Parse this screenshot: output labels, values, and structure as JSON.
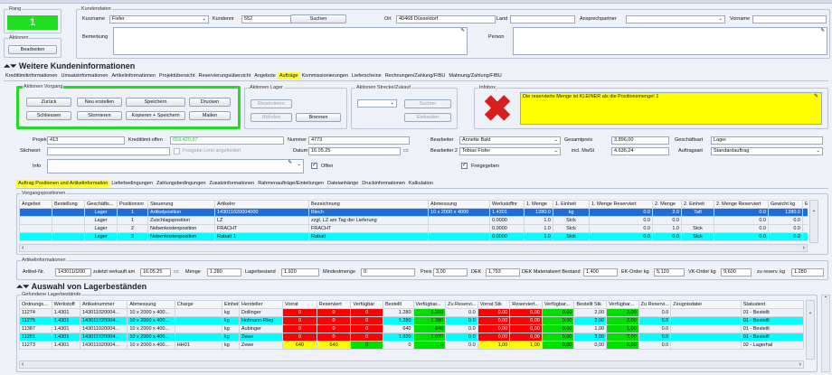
{
  "rang": {
    "label": "Rang",
    "value": "1"
  },
  "aktionen": {
    "label": "Aktionen",
    "bearbeiten": "Bearbeiten"
  },
  "kundendaten": {
    "label": "Kundendaten",
    "kurzname_label": "Kurzname",
    "kurzname": "Fisfer",
    "kundennr_label": "Kundennr",
    "kundennr": "552",
    "suchen": "Suchen",
    "ort_label": "Ort",
    "ort": "40468 Düsseldorf",
    "land_label": "Land",
    "ansprech_label": "Ansprechpartner",
    "vorname_label": "Vorname",
    "bemerkung_label": "Bemerkung",
    "person_label": "Person"
  },
  "weitere_title": "Weitere Kundeninformationen",
  "main_tabs": [
    "Kreditlimitinformationen",
    "Umsatzinformationen",
    "Artikelinformationen",
    "Projektübersicht",
    "Reservierungsübersicht",
    "Angebote",
    "Aufträge",
    "Kommissionierungen",
    "Lieferscheine",
    "Rechnungen/Zahlung/FIBU",
    "Mahnung/Zahlung/FIBU"
  ],
  "main_tab_active": 6,
  "vorgang": {
    "label": "Aktionen Vorgang",
    "buttons": [
      "Zurück",
      "Neu erstellen",
      "Speichern",
      "Drucken",
      "Schliessen",
      "Stornieren",
      "Kopieren + Speichern",
      "Mailen"
    ]
  },
  "lager": {
    "label": "Aktionen Lager",
    "reservieren": "Reservieren",
    "abholen": "Abholen",
    "brennen": "Brennen"
  },
  "strecke": {
    "label": "Aktionen Strecke/Zukauf",
    "suchen": "Suchen",
    "einkaufen": "Einkaufen"
  },
  "infobox": {
    "label": "Infobox",
    "message": "Die reservierte Menge ist KLEINER als die Positionsmenge! 1"
  },
  "form": {
    "projekt_label": "Projekt",
    "projekt": "413",
    "kredit_label": "Kreditlimit offen",
    "kredit": "659.420,97",
    "nummer_label": "Nummer",
    "nummer": "4773",
    "bearbeiter_label": "Bearbeiter",
    "bearbeiter": "Annette Bald",
    "gesamt_label": "Gesamtpreis",
    "gesamt": "3.896,00",
    "gart_label": "Geschäftsart",
    "gart": "Lager",
    "stichwort_label": "Stichwort",
    "freigabe_label": "Freigabe Limit angefordert",
    "datum_label": "Datum",
    "datum": "16.05.25",
    "bearbeiter2_label": "Bearbeiter 2",
    "bearbeiter2": "Tobias Fisfer",
    "mwst_label": "incl. MwSt",
    "mwst": "4.636,24",
    "aart_label": "Auftragsart",
    "aart": "Standardauftrag",
    "info_label": "Info",
    "offen_label": "Offen",
    "freigegeben_label": "Freigegeben"
  },
  "sub_tabs": [
    "Auftrag Positionen und Artikelinformation",
    "Lieferbedingungen",
    "Zahlungsbedingungen",
    "Zusatzinformationen",
    "Rahmenaufträge/Einteilungen",
    "Dateianhänge",
    "Druckinformationen",
    "Kalkulation"
  ],
  "positionen": {
    "label": "Vorgangspositionen",
    "headers": [
      "Angebot",
      "Bestellung",
      "Geschäfts...",
      "Positionsnr",
      "Steuerung",
      "Artikelnr",
      "Bezeichnung",
      "Abmessung",
      "Werkstoffnr",
      "1. Menge",
      "1. Einheit",
      "1. Menge Reserviert",
      "2. Menge",
      "2. Einheit",
      "2. Menge Reserviert",
      "Gewicht kg",
      "Einzelpreis",
      "f"
    ],
    "rows": [
      [
        "",
        "",
        "Lager",
        "1",
        "Artikelposition",
        "143011020004000",
        "Blech",
        "10 x 2000 x 4000",
        "1.4301",
        "1280.0",
        "kg",
        "0.0",
        "2.0",
        "Tafl",
        "0.0",
        "1280.0",
        "3.0",
        ""
      ],
      [
        "",
        "",
        "Lager",
        "1",
        "Zuschlagsposition",
        "LZ",
        "zzgl. LZ am Tag der Lieferung",
        "",
        "0.0000",
        "1.0",
        "Stck",
        "0.0",
        "0.0",
        "",
        "0.0",
        "0.0",
        "1.0",
        ""
      ],
      [
        "",
        "",
        "Lager",
        "2",
        "Nebenkostenposition",
        "FRACHT",
        "FRACHT",
        "",
        "0.0000",
        "1.0",
        "Stck",
        "0.0",
        "1.0",
        "Stck",
        "0.0",
        "0.0",
        "50.0",
        ""
      ],
      [
        "",
        "",
        "Lager",
        "3",
        "Nebenkostenposition",
        "Rabatt 1",
        "Rabatt",
        "",
        "0.0000",
        "1.0",
        "Stck",
        "0.0",
        "0.0",
        "Stck",
        "0.0",
        "0.0",
        "5.0",
        ""
      ]
    ]
  },
  "artikel": {
    "label": "Artikelinformationen",
    "nr_label": "Artikel-Nr.",
    "nr": "1430110200",
    "zuletzt_label": "zuletzt verkauft am",
    "zuletzt": "16.05.25",
    "menge_label": "Menge",
    "menge": "1.280",
    "lagerbestand_label": "Lagerbestand",
    "lagerbestand": "1.920",
    "mindest_label": "Mindestmenge",
    "mindest": "0",
    "preis_label": "Preis",
    "preis": "3,00",
    "dek_label": "DEK",
    "dek": "1,793",
    "dekmat_label": "DEK Materialwert Bestand",
    "dekmat": "1,400",
    "ek_label": "EK-Order kg",
    "ek": "5,120",
    "vk_label": "VK-Order kg",
    "vk": "9,600",
    "zures_label": "zu reserv. kg",
    "zures": "1.280"
  },
  "lager_title": "Auswahl von Lagerbeständen",
  "bestaende": {
    "label": "Gefundene Lagerbestände",
    "headers": [
      "Ordnungs...",
      "Werkstoff",
      "Artikelnummer",
      "Abmessung",
      "Charge",
      "Einheit",
      "Hersteller",
      "Vorrat",
      "Reserviert",
      "Verfügbar",
      "Bestellt",
      "Verfügbar...",
      "Zu Reservi...",
      "Vorrat Stk",
      "Reserviert...",
      "Verfügbar...",
      "Bestellt Stk",
      "Verfügbar...",
      "Zu Reservi...",
      "Zeugnisdatei",
      "Statustext"
    ],
    "rows": [
      [
        "11274",
        "1.4301",
        "143011020004...",
        "10 x 2000 x 400...",
        "",
        "kg",
        "Dollinger",
        "0",
        "0",
        "0",
        "1.280",
        "1.280",
        "0.0",
        "0.00",
        "0,00",
        "0,00",
        "2,00",
        "2,00",
        "0.0",
        "",
        "01 - Bestellt"
      ],
      [
        "11275",
        "1.4301",
        "143011020004...",
        "10 x 2000 x 400...",
        "",
        "kg",
        "Hofmann-Rieg",
        "0",
        "0",
        "0",
        "1.280",
        "1.280",
        "0.0",
        "0,00",
        "0,00",
        "0,00",
        "2,00",
        "2,00",
        "0.0",
        "",
        "01 - Bestellt"
      ],
      [
        "11387",
        "1.4301",
        "143011020004...",
        "10 x 2000 x 400...",
        "",
        "kg",
        "Aubinger",
        "0",
        "0",
        "0",
        "640",
        "640",
        "0.0",
        "0,00",
        "0,00",
        "0,00",
        "1,00",
        "1,00",
        "0.0",
        "",
        "01 - Bestellt"
      ],
      [
        "11281",
        "1.4301",
        "143011020004...",
        "10 x 2000 x 400...",
        "",
        "kg",
        "Zewe",
        "0",
        "0",
        "0",
        "1.920",
        "1.920",
        "0.0",
        "0,00",
        "0,00",
        "0,00",
        "3,00",
        "3,00",
        "0.0",
        "",
        "01 - Bestellt"
      ],
      [
        "11273",
        "1.4301",
        "143011020004...",
        "10 x 2000 x 400...",
        "HH01",
        "kg",
        "Zewe",
        "640",
        "640",
        "0",
        "0",
        "0",
        "0.0",
        "1,00",
        "1,00",
        "0,00",
        "0,00",
        "0,00",
        "0.0",
        "",
        "02 - Lagerhal"
      ]
    ]
  },
  "colors": {
    "accent_green": "#22dd22",
    "warn_yellow": "#ffff00",
    "cyan": "#00ffff",
    "red": "#ff0000",
    "select_blue": "#1d6ed8"
  }
}
